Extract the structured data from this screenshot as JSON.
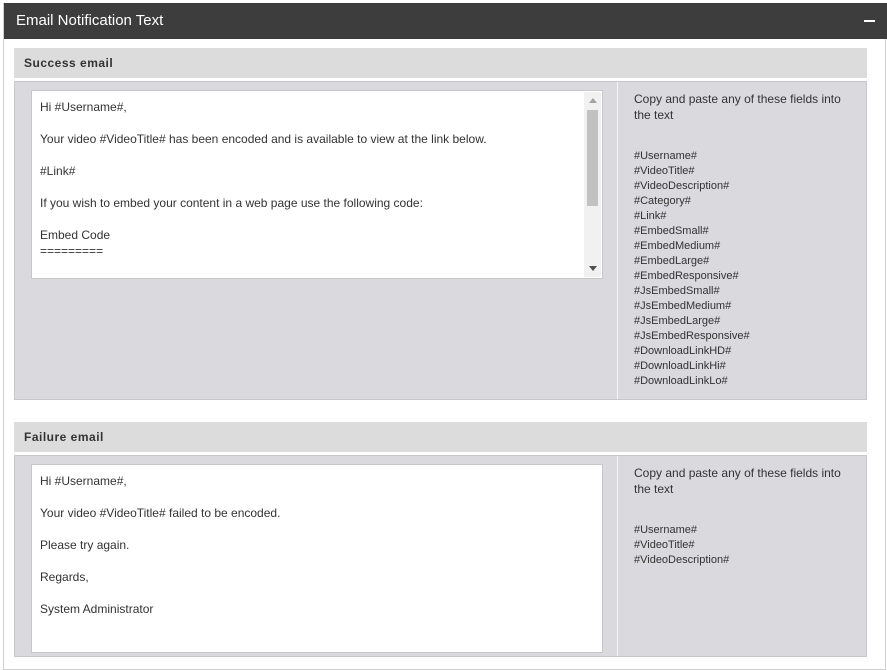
{
  "panel": {
    "title": "Email Notification Text"
  },
  "success": {
    "title": "Success email",
    "lines": [
      "Hi #Username#,",
      "",
      "Your video #VideoTitle# has been encoded and is available to view at the link below.",
      "",
      "#Link#",
      "",
      "If you wish to embed your content in a web page use the following code:",
      "",
      "Embed Code",
      "========="
    ],
    "help": "Copy and paste any of these fields into the text",
    "fields": [
      "#Username#",
      "#VideoTitle#",
      "#VideoDescription#",
      "#Category#",
      "#Link#",
      "#EmbedSmall#",
      "#EmbedMedium#",
      "#EmbedLarge#",
      "#EmbedResponsive#",
      "#JsEmbedSmall#",
      "#JsEmbedMedium#",
      "#JsEmbedLarge#",
      "#JsEmbedResponsive#",
      "#DownloadLinkHD#",
      "#DownloadLinkHi#",
      "#DownloadLinkLo#"
    ]
  },
  "failure": {
    "title": "Failure email",
    "lines": [
      "Hi #Username#,",
      "",
      "Your video #VideoTitle# failed to be encoded.",
      "",
      "Please try again.",
      "",
      "Regards,",
      "",
      "System Administrator"
    ],
    "help": "Copy and paste any of these fields into the text",
    "fields": [
      "#Username#",
      "#VideoTitle#",
      "#VideoDescription#"
    ]
  },
  "icons": {
    "collapse": "minus-icon",
    "scroll_up": "chevron-up-icon",
    "scroll_down": "chevron-down-icon"
  },
  "colors": {
    "header_bg": "#3d3d3d",
    "section_header_bg": "#dcdcdc",
    "section_body_bg": "#d9d9de"
  }
}
